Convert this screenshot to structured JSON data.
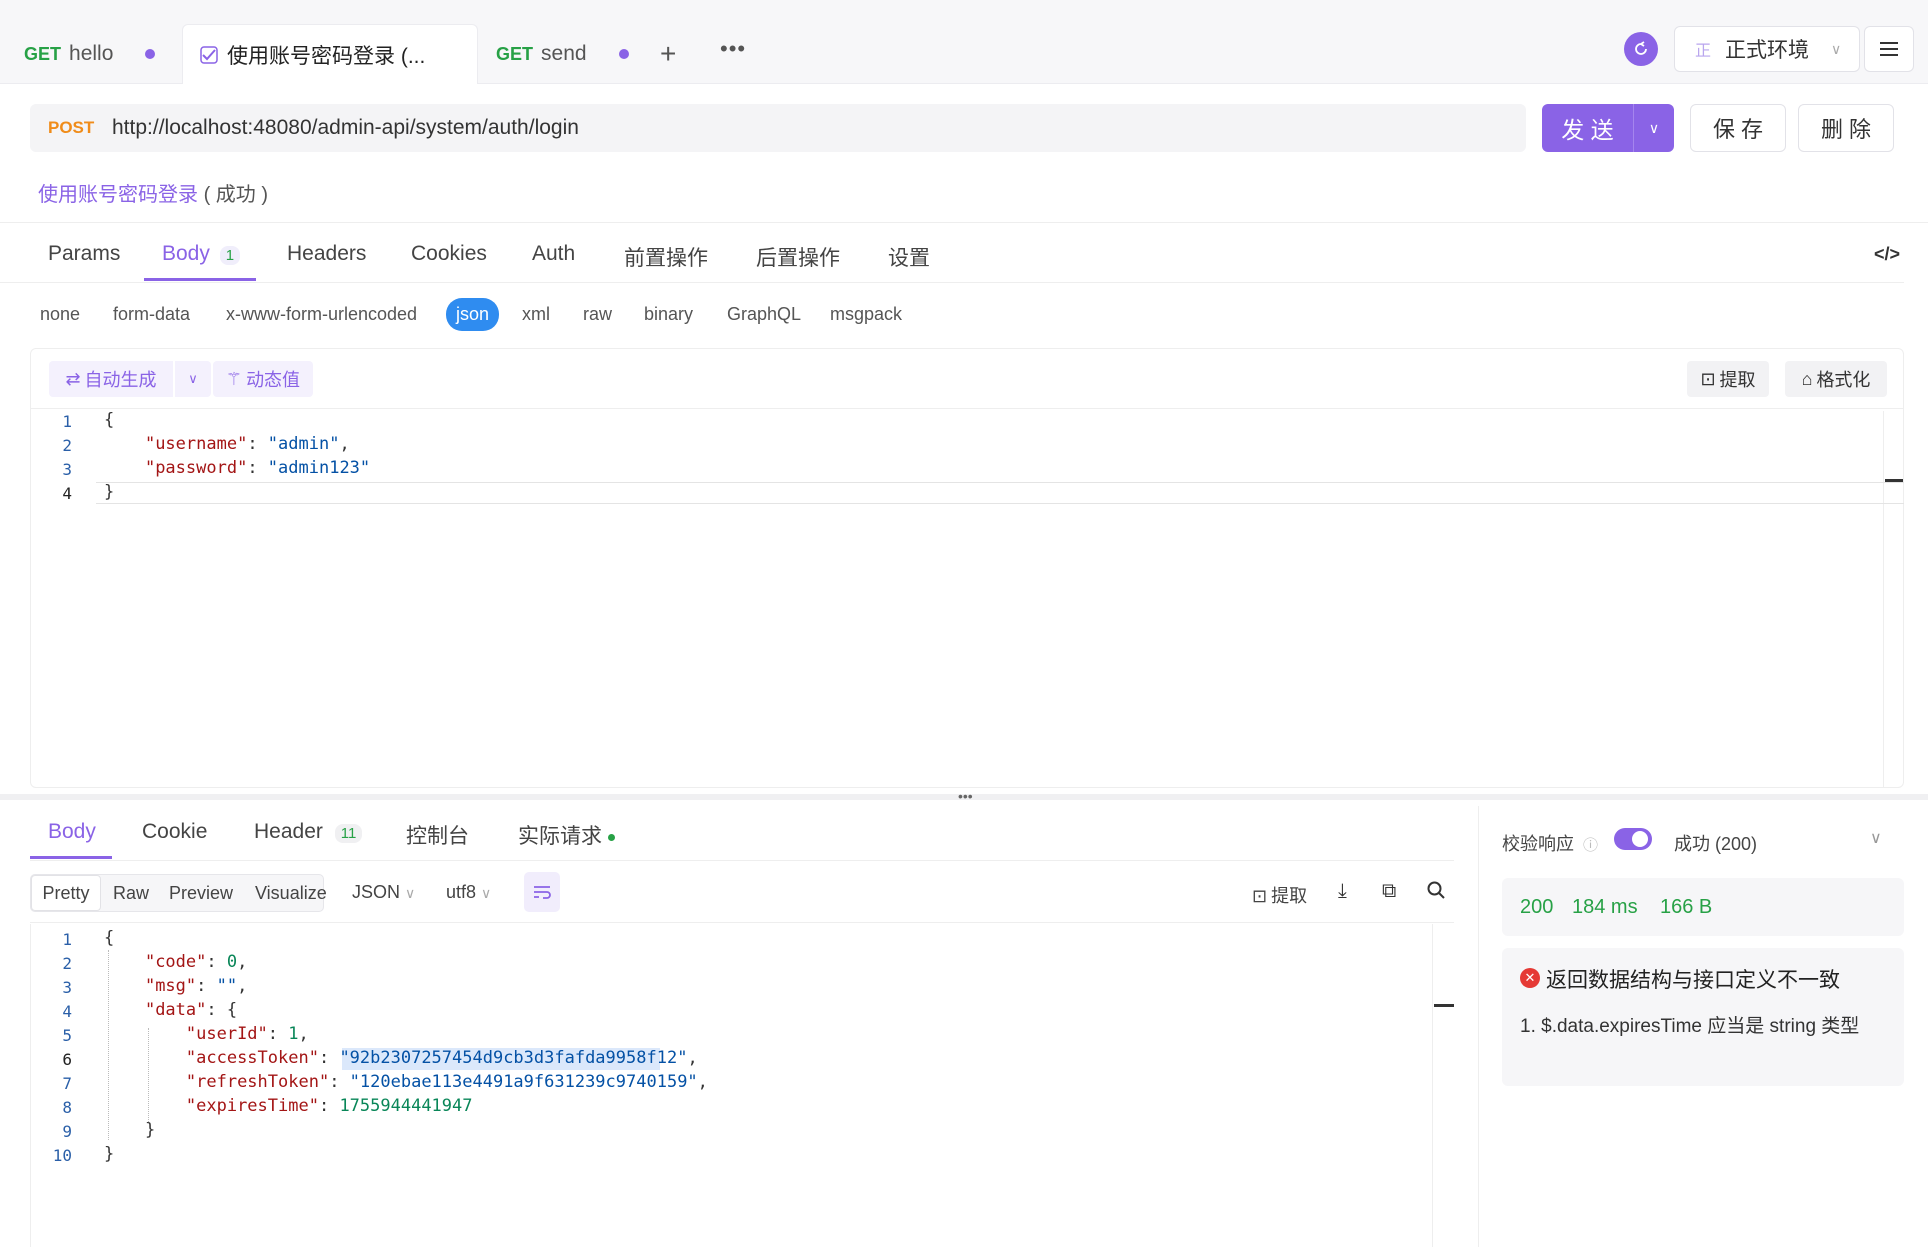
{
  "tabs": [
    {
      "method": "GET",
      "name": "hello"
    },
    {
      "name": "使用账号密码登录 (..."
    },
    {
      "method": "GET",
      "name": "send"
    }
  ],
  "env": {
    "badge": "正",
    "name": "正式环境"
  },
  "request": {
    "method": "POST",
    "url": "http://localhost:48080/admin-api/system/auth/login"
  },
  "actions": {
    "send": "发 送",
    "save": "保 存",
    "delete": "删 除"
  },
  "api": {
    "name": "使用账号密码登录",
    "status": "( 成功 )"
  },
  "request_tabs": [
    "Params",
    "Body",
    "Headers",
    "Cookies",
    "Auth",
    "前置操作",
    "后置操作",
    "设置"
  ],
  "body_count": "1",
  "body_types": [
    "none",
    "form-data",
    "x-www-form-urlencoded",
    "json",
    "xml",
    "raw",
    "binary",
    "GraphQL",
    "msgpack"
  ],
  "editor_tools": {
    "auto_gen": "自动生成",
    "dynamic": "动态值",
    "extract": "提取",
    "format": "格式化"
  },
  "request_body": {
    "lines": [
      "1",
      "2",
      "3",
      "4"
    ],
    "username_key": "\"username\"",
    "username_val": "\"admin\"",
    "password_key": "\"password\"",
    "password_val": "\"admin123\""
  },
  "response_tabs": {
    "body": "Body",
    "cookie": "Cookie",
    "header": "Header",
    "header_count": "11",
    "console": "控制台",
    "actual": "实际请求"
  },
  "view_modes": [
    "Pretty",
    "Raw",
    "Preview",
    "Visualize"
  ],
  "format_select": "JSON",
  "encoding_select": "utf8",
  "resp_extract": "提取",
  "response_body": {
    "lines": [
      "1",
      "2",
      "3",
      "4",
      "5",
      "6",
      "7",
      "8",
      "9",
      "10"
    ],
    "code_key": "\"code\"",
    "code_val": "0",
    "msg_key": "\"msg\"",
    "msg_val": "\"\"",
    "data_key": "\"data\"",
    "userId_key": "\"userId\"",
    "userId_val": "1",
    "accessToken_key": "\"accessToken\"",
    "accessToken_val": "\"92b2307257454d9cb3d3fafda9958f12\"",
    "refreshToken_key": "\"refreshToken\"",
    "refreshToken_val": "\"120ebae113e4491a9f631239c9740159\"",
    "expiresTime_key": "\"expiresTime\"",
    "expiresTime_val": "1755944441947"
  },
  "validate": {
    "label": "校验响应",
    "result": "成功 (200)",
    "status": "200",
    "time": "184 ms",
    "size": "166 B",
    "error_title": "返回数据结构与接口定义不一致",
    "error_detail": "1. $.data.expiresTime 应当是 string 类型"
  },
  "colors": {
    "accent": "#8a63e6",
    "get": "#27a146",
    "post": "#f08c1a",
    "error": "#e53935"
  }
}
